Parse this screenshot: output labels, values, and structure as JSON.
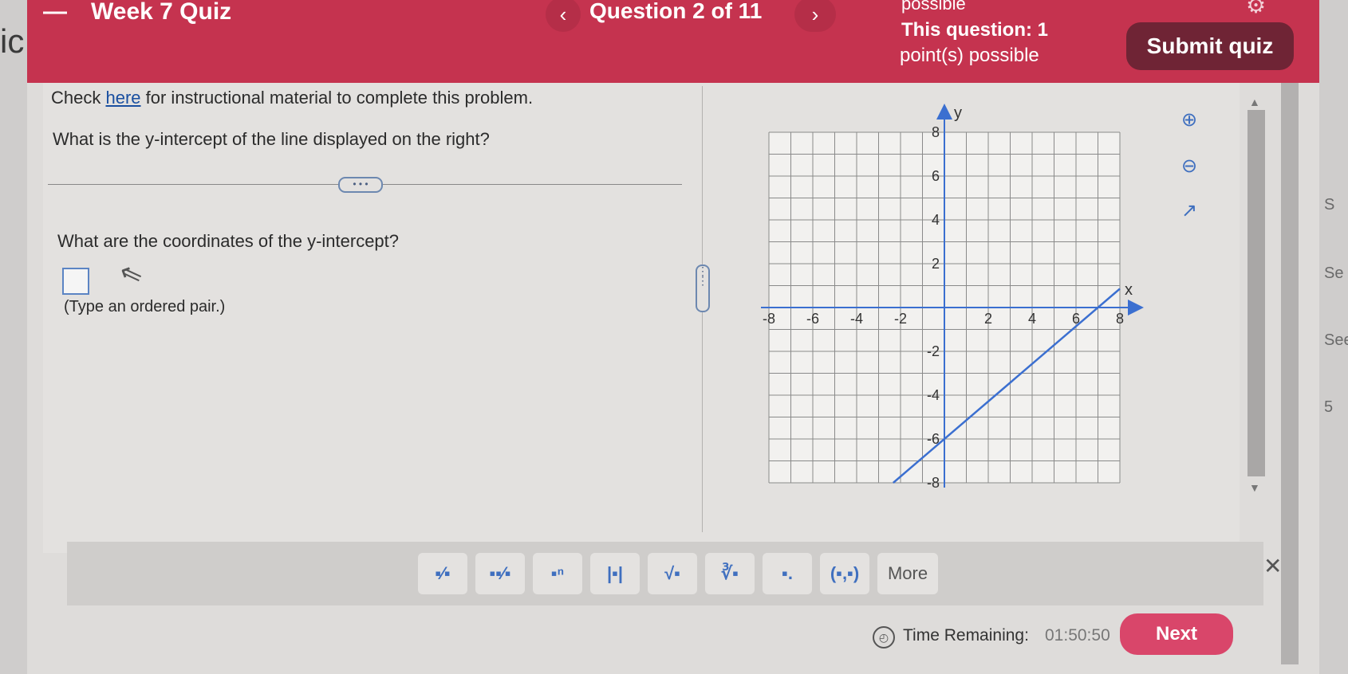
{
  "header": {
    "quiz_title": "Week 7 Quiz",
    "dash": "—",
    "prev_icon": "‹",
    "question_counter": "Question 2 of 11",
    "next_icon": "›",
    "possible_top": "possible",
    "points_line1": "This question: 1",
    "points_line2": "point(s) possible",
    "submit_label": "Submit quiz"
  },
  "content": {
    "instruction_before": "Check ",
    "instruction_link": "here",
    "instruction_after": " for instructional material to complete this problem.",
    "question": "What is the y-intercept of the line displayed on the right?",
    "more_pill": "• • •",
    "question2": "What are the coordinates of the y-intercept?",
    "hint": "(Type an ordered pair.)"
  },
  "graph": {
    "x_label": "x",
    "y_label": "y",
    "x_ticks": [
      "-8",
      "-6",
      "-4",
      "-2",
      "2",
      "4",
      "6",
      "8"
    ],
    "y_ticks": [
      "8",
      "6",
      "4",
      "2",
      "-2",
      "-4",
      "-6",
      "-8"
    ],
    "line_color": "#3b6fd0",
    "line": {
      "slope": 0.8571,
      "intercept": -6
    }
  },
  "toolbar": {
    "buttons": [
      "▪⁄▪",
      "▪▪⁄▪",
      "▪ⁿ",
      "|▪|",
      "√▪",
      "∛▪",
      "▪.",
      "(▪,▪)"
    ],
    "more_label": "More",
    "close_icon": "✕"
  },
  "footer": {
    "time_label": "Time Remaining:",
    "time_value": "01:50:50",
    "next_label": "Next"
  },
  "side": {
    "left_fragment": "ic",
    "right_fragments": [
      "S",
      "Se",
      "See",
      "5"
    ]
  }
}
